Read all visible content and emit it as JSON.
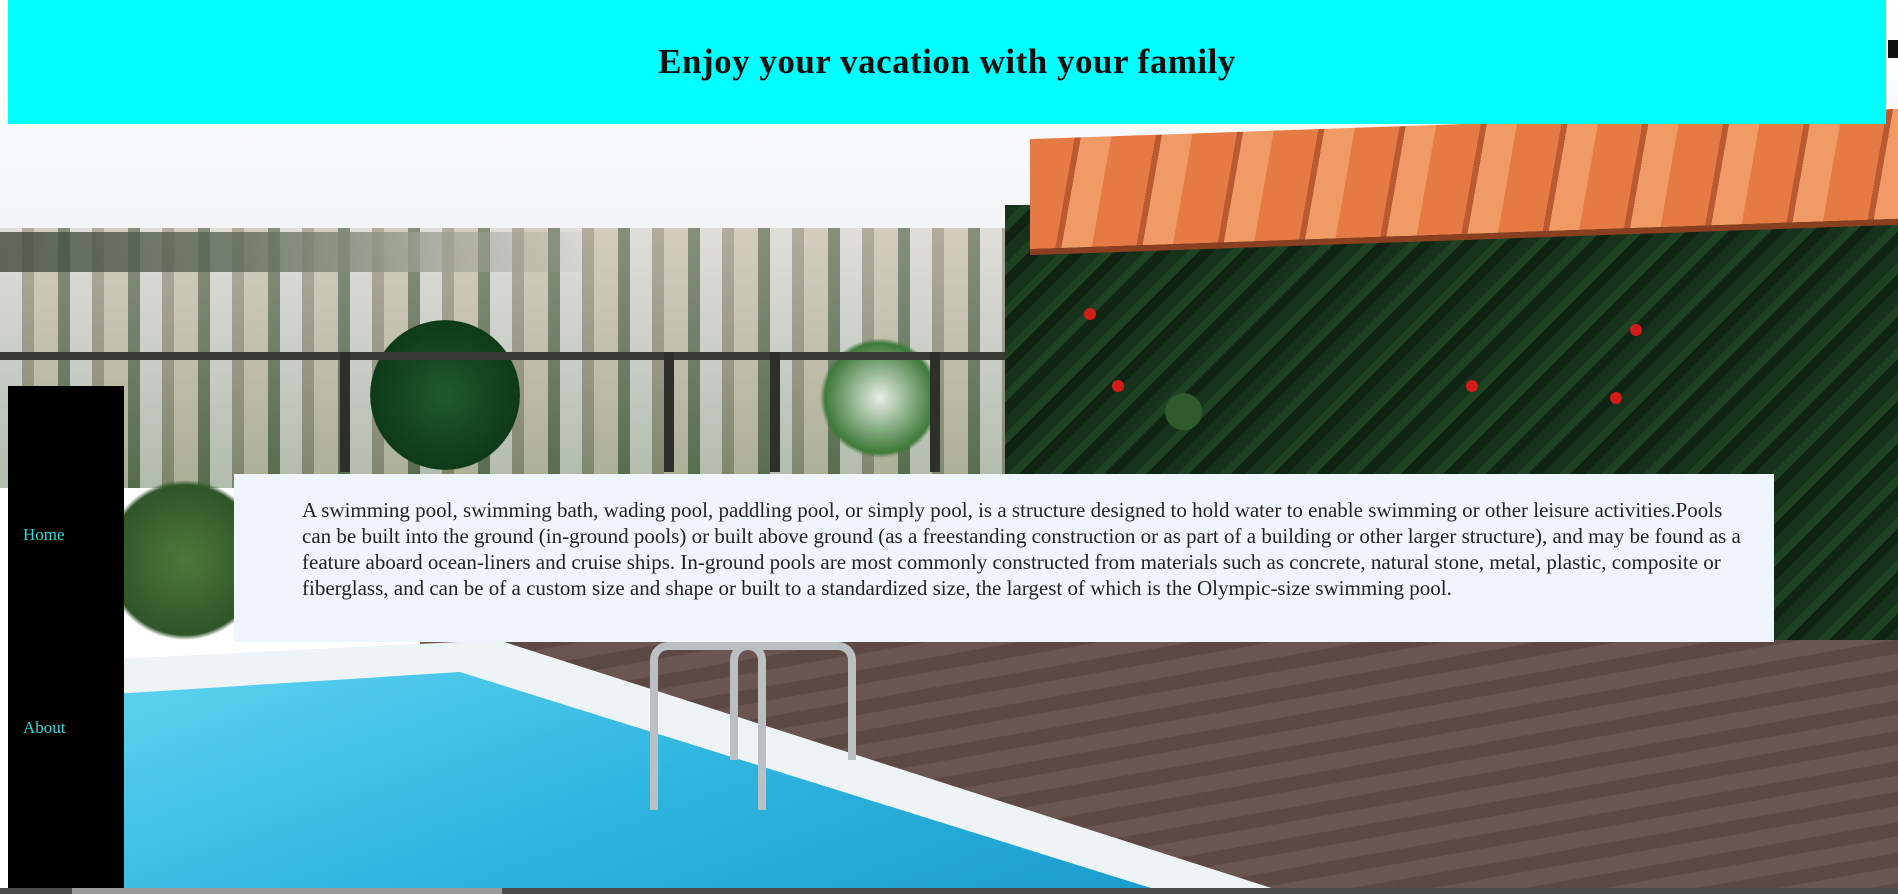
{
  "header": {
    "title": "Enjoy your vacation with your family",
    "background_color": "#00ffff"
  },
  "sidebar": {
    "background_color": "#000000",
    "link_color": "#34d9d9",
    "items": [
      {
        "label": "Home"
      },
      {
        "label": "About"
      }
    ]
  },
  "main": {
    "paragraph": "A swimming pool, swimming bath, wading pool, paddling pool, or simply pool, is a structure designed to hold water to enable swimming or other leisure activities.Pools can be built into the ground (in-ground pools) or built above ground (as a freestanding construction or as part of a building or other larger structure), and may be found as a feature aboard ocean-liners and cruise ships. In-ground pools are most commonly constructed from materials such as concrete, natural stone, metal, plastic, composite or fiberglass, and can be of a custom size and shape or built to a standardized size, the largest of which is the Olympic-size swimming pool.",
    "background_color": "#eef5fc"
  },
  "background": {
    "description_icon": "rooftop-pool-image"
  }
}
